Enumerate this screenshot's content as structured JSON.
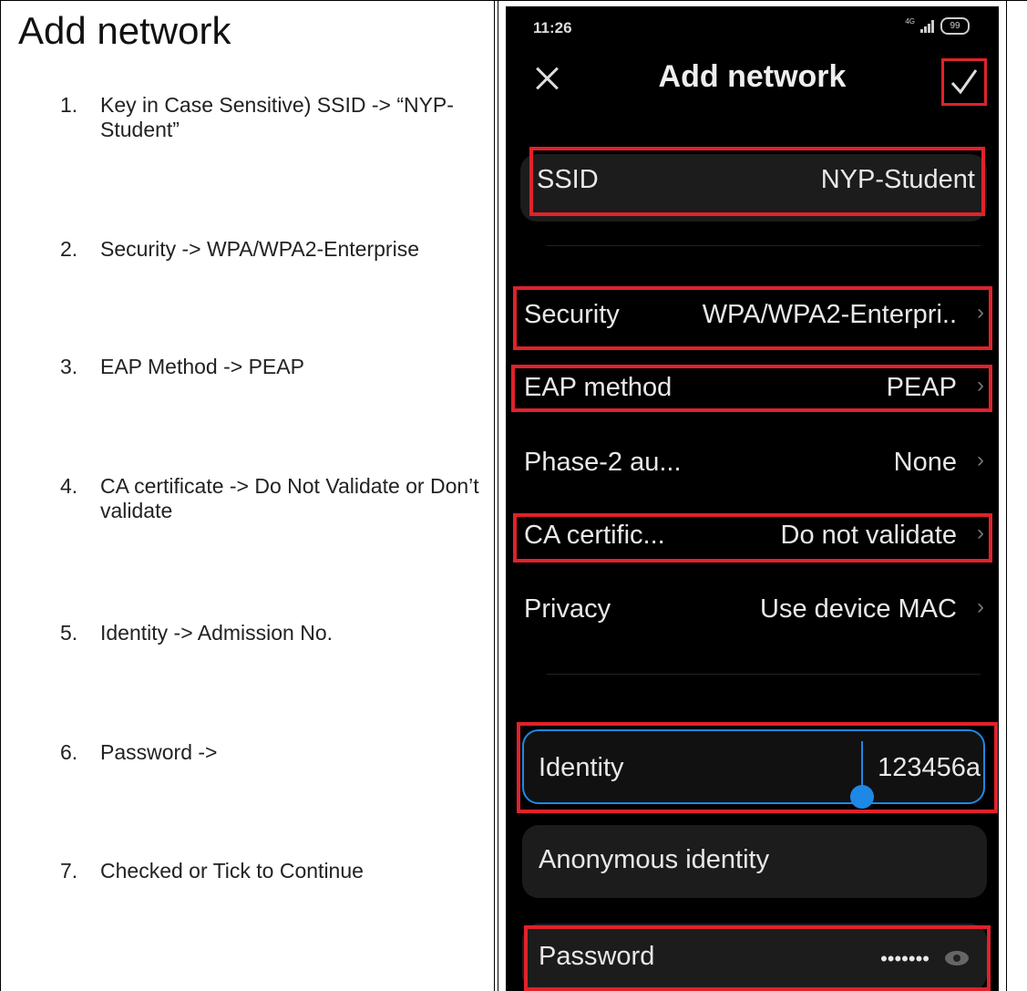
{
  "doc": {
    "title": "Add network",
    "steps": [
      {
        "num": "1.",
        "text": "Key in Case Sensitive) SSID -> “NYP-Student”"
      },
      {
        "num": "2.",
        "text": "Security ->  WPA/WPA2-Enterprise"
      },
      {
        "num": "3.",
        "text": "EAP Method -> PEAP"
      },
      {
        "num": "4.",
        "text": "CA certificate -> Do Not Validate or Don’t validate"
      },
      {
        "num": "5.",
        "text": "Identity -> Admission No."
      },
      {
        "num": "6.",
        "text": "Password ->"
      },
      {
        "num": "7.",
        "text": "Checked or Tick to Continue"
      }
    ]
  },
  "phone": {
    "status": {
      "time": "11:26",
      "battery": "99",
      "network": "4G"
    },
    "title": "Add network",
    "fields": {
      "ssid": {
        "label": "SSID",
        "value": "NYP-Student"
      },
      "security": {
        "label": "Security",
        "value": "WPA/WPA2-Enterpri.."
      },
      "eap": {
        "label": "EAP method",
        "value": "PEAP"
      },
      "phase2": {
        "label": "Phase-2 au...",
        "value": "None"
      },
      "ca": {
        "label": "CA certific...",
        "value": "Do not validate"
      },
      "privacy": {
        "label": "Privacy",
        "value": "Use device MAC"
      },
      "identity": {
        "label": "Identity",
        "value": "123456a"
      },
      "anonymous": {
        "label": "Anonymous identity"
      },
      "password": {
        "label": "Password",
        "value": "•••••••"
      }
    },
    "chevron": "›"
  },
  "colors": {
    "highlight": "#e0222a",
    "phone_bg": "#000000",
    "cursor": "#1e88e5"
  }
}
